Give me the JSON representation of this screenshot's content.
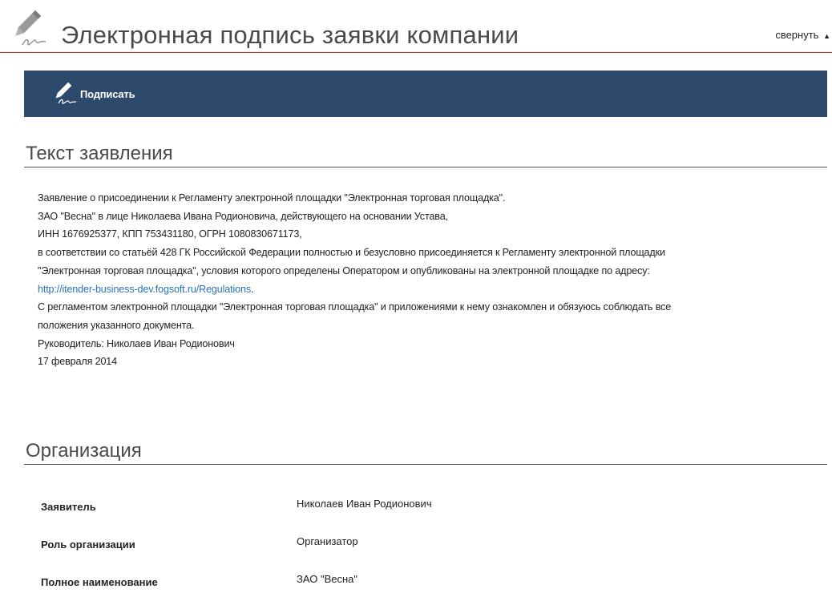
{
  "header": {
    "title": "Электронная подпись заявки компании",
    "collapse_label": "свернуть",
    "icon": "signature-pen-icon"
  },
  "toolbar": {
    "sign_label": "Подписать",
    "background": "#2d4a6d"
  },
  "statement_section": {
    "title": "Текст заявления",
    "lines": [
      "Заявление о присоединении к Регламенту электронной площадки \"Электронная торговая площадка\".",
      "ЗАО \"Весна\" в лице Николаева Ивана Родионовича, действующего на основании Устава,",
      "ИНН 1676925377, КПП 753431180, ОГРН 1080830671173,",
      "в соответствии со статьёй 428 ГК Российской Федерации полностью и безусловно присоединяется к Регламенту электронной площадки",
      "\"Электронная торговая площадка\", условия которого определены Оператором и опубликованы на электронной площадке по адресу:"
    ],
    "link": "http://itender-business-dev.fogsoft.ru/Regulations",
    "link_suffix": ".",
    "lines_after": [
      "С регламентом электронной площадки \"Электронная торговая площадка\" и приложениями к нему ознакомлен и обязуюсь соблюдать все",
      "положения указанного документа.",
      "Руководитель: Николаев Иван Родионович",
      "17 февраля 2014"
    ]
  },
  "organization_section": {
    "title": "Организация",
    "rows": [
      {
        "label": "Заявитель",
        "value": "Николаев Иван Родионович"
      },
      {
        "label": "Роль организации",
        "value": "Организатор"
      },
      {
        "label": "Полное наименование",
        "value": "ЗАО \"Весна\""
      }
    ]
  },
  "colors": {
    "accent_line": "#c62828",
    "link": "#2a73b8"
  }
}
